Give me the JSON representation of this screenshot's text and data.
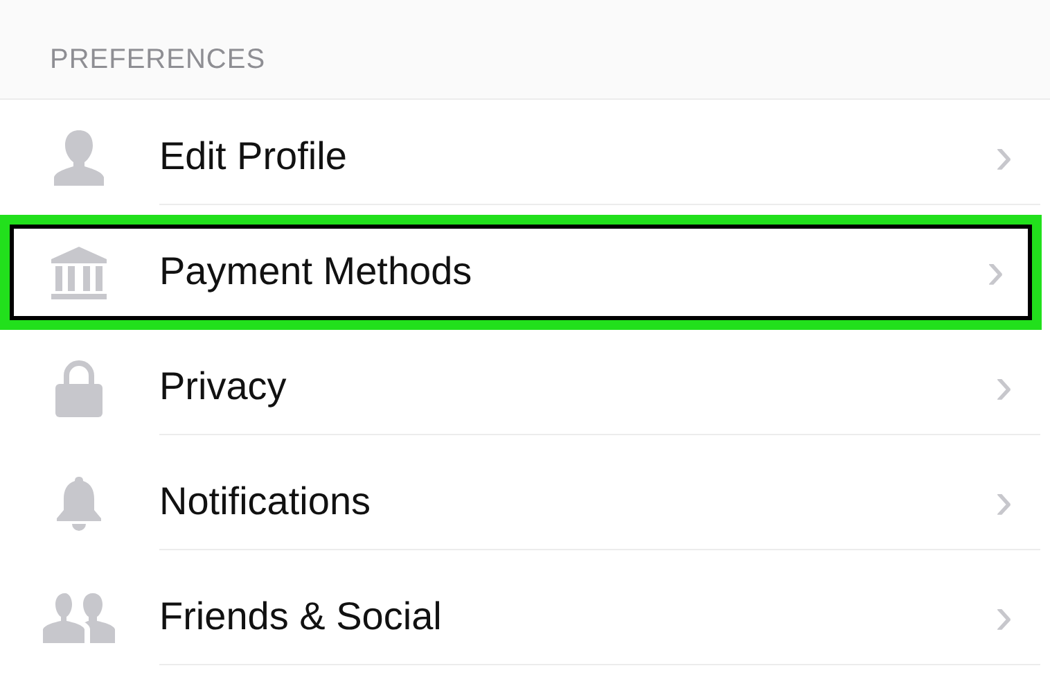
{
  "section": {
    "title": "PREFERENCES"
  },
  "items": [
    {
      "kind": "person",
      "label": "Edit Profile",
      "chevron": "›",
      "highlighted": false
    },
    {
      "kind": "bank",
      "label": "Payment Methods",
      "chevron": "›",
      "highlighted": true
    },
    {
      "kind": "lock",
      "label": "Privacy",
      "chevron": "›",
      "highlighted": false
    },
    {
      "kind": "bell",
      "label": "Notifications",
      "chevron": "›",
      "highlighted": false
    },
    {
      "kind": "people",
      "label": "Friends & Social",
      "chevron": "›",
      "highlighted": false
    }
  ]
}
